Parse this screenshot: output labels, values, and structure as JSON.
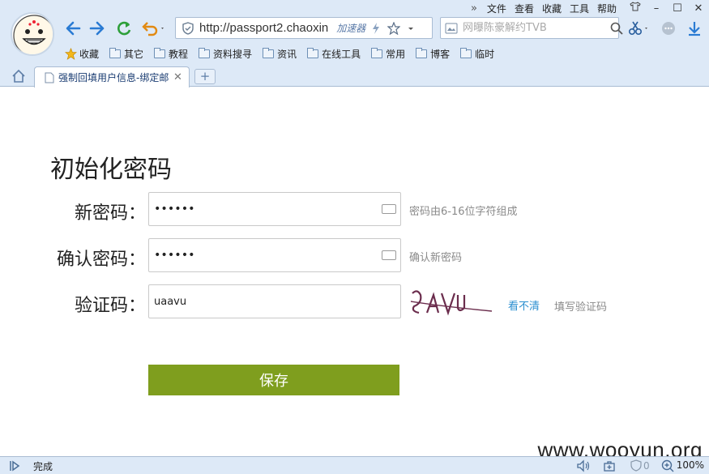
{
  "browser": {
    "menu": [
      "文件",
      "查看",
      "收藏",
      "工具",
      "帮助"
    ],
    "url": "http://passport2.chaoxin",
    "accelerator_label": "加速器",
    "search_placeholder": "网曝陈豪解约TVB",
    "bookmarks": [
      "收藏",
      "其它",
      "教程",
      "资料搜寻",
      "资讯",
      "在线工具",
      "常用",
      "博客",
      "临时"
    ],
    "tab_title": "强制回填用户信息-绑定邮箱",
    "status": "完成",
    "zoom": "100%",
    "security_count": "0"
  },
  "form": {
    "title": "初始化密码",
    "new_password_label": "新密码：",
    "new_password_value": "••••••",
    "new_password_hint": "密码由6-16位字符组成",
    "confirm_password_label": "确认密码：",
    "confirm_password_value": "••••••",
    "confirm_password_hint": "确认新密码",
    "captcha_label": "验证码：",
    "captcha_value": "uaavu",
    "captcha_refresh": "看不清",
    "captcha_hint": "填写验证码",
    "save_label": "保存"
  },
  "watermark": "www.wooyun.org",
  "colors": {
    "save_button": "#7f9e1e",
    "link": "#2b8fd0",
    "chrome": "#dde9f7"
  }
}
